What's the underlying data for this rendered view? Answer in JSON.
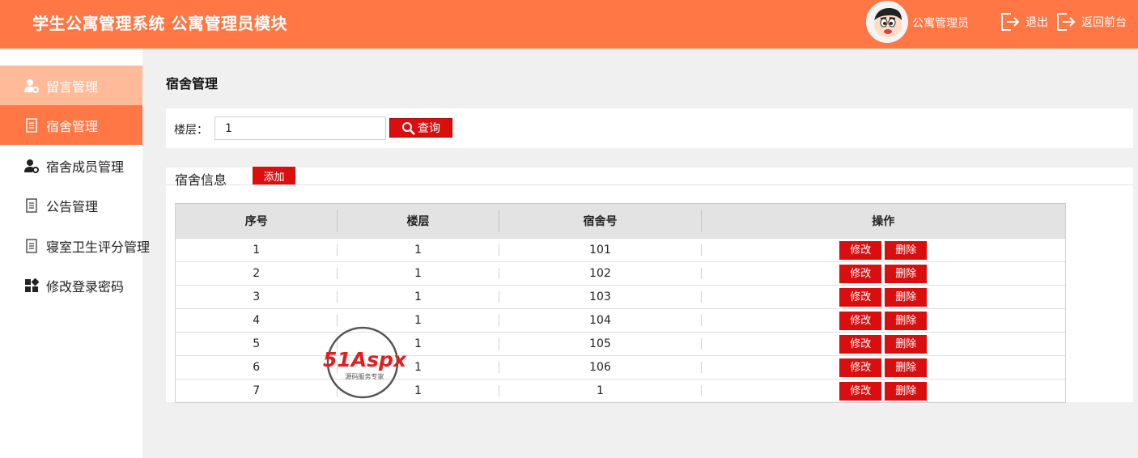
{
  "header": {
    "title": "学生公寓管理系统 公寓管理员模块",
    "username": "公寓管理员",
    "logout_label": "退出",
    "frontpage_label": "返回前台"
  },
  "sidebar": {
    "items": [
      {
        "label": "留言管理",
        "icon": "user-gear-icon",
        "state": "hover"
      },
      {
        "label": "宿舍管理",
        "icon": "document-icon",
        "state": "active"
      },
      {
        "label": "宿舍成员管理",
        "icon": "user-gear-icon",
        "state": ""
      },
      {
        "label": "公告管理",
        "icon": "document-icon",
        "state": ""
      },
      {
        "label": "寝室卫生评分管理",
        "icon": "document-icon",
        "state": ""
      },
      {
        "label": "修改登录密码",
        "icon": "grid-icon",
        "state": ""
      }
    ]
  },
  "main": {
    "page_title": "宿舍管理",
    "search": {
      "label": "楼层：",
      "value": "1",
      "button_label": "查询"
    },
    "info": {
      "title": "宿舍信息",
      "add_label": "添加"
    },
    "table": {
      "headers": [
        "序号",
        "楼层",
        "宿舍号",
        "操作"
      ],
      "edit_label": "修改",
      "delete_label": "删除",
      "rows": [
        [
          "1",
          "1",
          "101"
        ],
        [
          "2",
          "1",
          "102"
        ],
        [
          "3",
          "1",
          "103"
        ],
        [
          "4",
          "1",
          "104"
        ],
        [
          "5",
          "1",
          "105"
        ],
        [
          "6",
          "1",
          "106"
        ],
        [
          "7",
          "1",
          "1"
        ]
      ]
    }
  },
  "watermark": {
    "brand": "51Aspx",
    "tagline": "源码服务专家"
  },
  "colors": {
    "header": "#ff7744",
    "sidebar_active": "#ff7744",
    "sidebar_hover": "#ffbb99",
    "button": "#d90f0f",
    "page_bg": "#f0f0f0"
  }
}
